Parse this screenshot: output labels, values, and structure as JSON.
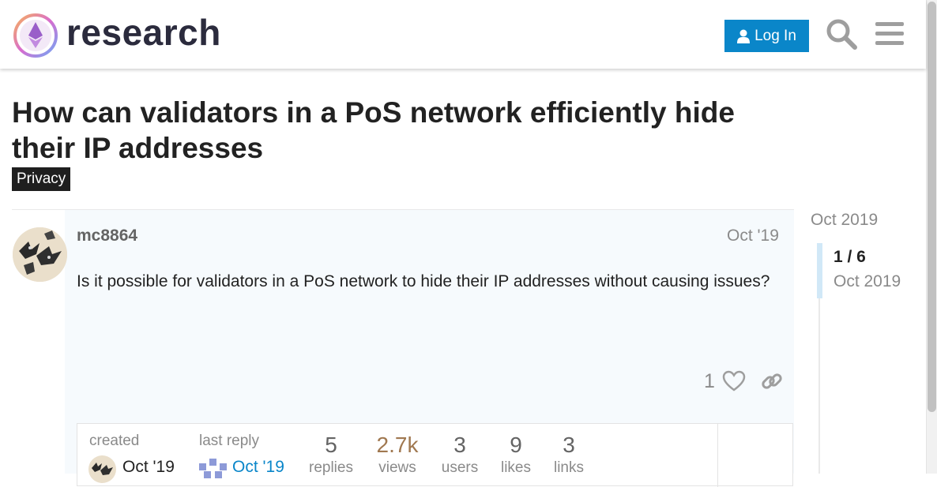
{
  "header": {
    "brand": "research",
    "login_label": "Log In",
    "icons": [
      "search-icon",
      "hamburger-menu-icon"
    ]
  },
  "topic": {
    "title": "How can validators in a PoS network efficiently hide their IP addresses",
    "category": "Privacy"
  },
  "post": {
    "username": "mc8864",
    "date": "Oct '19",
    "body": "Is it possible for validators in a PoS network to hide their IP addresses without causing issues?",
    "like_count": "1"
  },
  "topic_map": {
    "created_label": "created",
    "created_date": "Oct '19",
    "last_reply_label": "last reply",
    "last_reply_date": "Oct '19",
    "stats": [
      {
        "value": "5",
        "label": "replies"
      },
      {
        "value": "2.7k",
        "label": "views"
      },
      {
        "value": "3",
        "label": "users"
      },
      {
        "value": "9",
        "label": "likes"
      },
      {
        "value": "3",
        "label": "links"
      }
    ]
  },
  "timeline": {
    "start_date": "Oct 2019",
    "position": "1 / 6",
    "current_date": "Oct 2019"
  },
  "colors": {
    "accent": "#0a86c9",
    "views_highlight": "#a07850",
    "category_bg": "#1f1f1f",
    "post_bg": "#f6fafd"
  }
}
